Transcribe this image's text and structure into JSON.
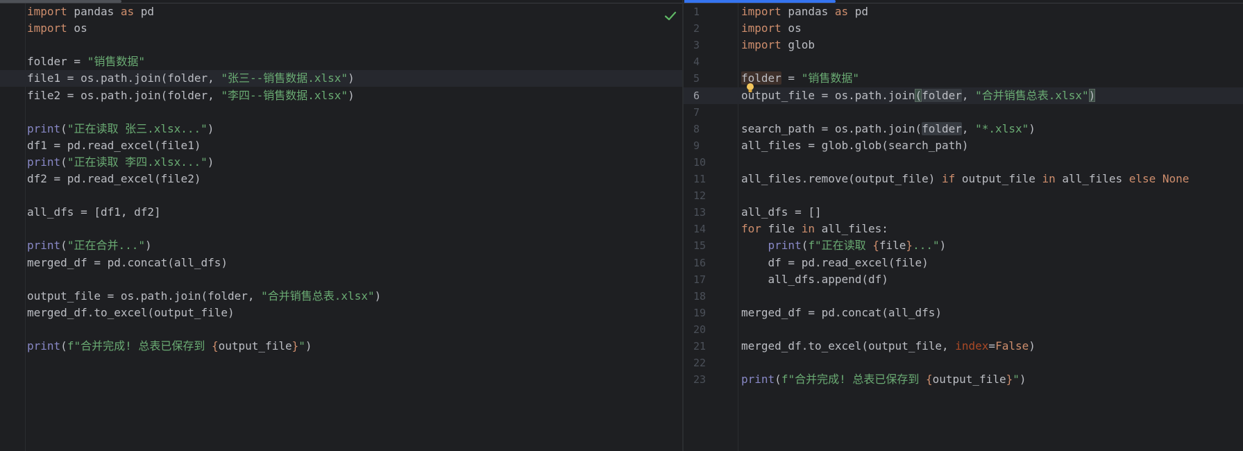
{
  "left_editor": {
    "lines": [
      [
        {
          "t": "import",
          "c": "kw"
        },
        {
          "t": " pandas "
        },
        {
          "t": "as",
          "c": "kw"
        },
        {
          "t": " pd"
        }
      ],
      [
        {
          "t": "import",
          "c": "kw"
        },
        {
          "t": " os"
        }
      ],
      [],
      [
        {
          "t": "folder = "
        },
        {
          "t": "\"销售数据\"",
          "c": "str"
        }
      ],
      [
        {
          "t": "file1 = os.path.join(folder, "
        },
        {
          "t": "\"张三--销售数据.xlsx\"",
          "c": "str"
        },
        {
          "t": ")"
        }
      ],
      [
        {
          "t": "file2 = os.path.join(folder, "
        },
        {
          "t": "\"李四--销售数据.xlsx\"",
          "c": "str"
        },
        {
          "t": ")"
        }
      ],
      [],
      [
        {
          "t": "print",
          "c": "fn"
        },
        {
          "t": "("
        },
        {
          "t": "\"正在读取 张三.xlsx...\"",
          "c": "str"
        },
        {
          "t": ")"
        }
      ],
      [
        {
          "t": "df1 = pd.read_excel(file1)"
        }
      ],
      [
        {
          "t": "print",
          "c": "fn"
        },
        {
          "t": "("
        },
        {
          "t": "\"正在读取 李四.xlsx...\"",
          "c": "str"
        },
        {
          "t": ")"
        }
      ],
      [
        {
          "t": "df2 = pd.read_excel(file2)"
        }
      ],
      [],
      [
        {
          "t": "all_dfs = [df1, df2]"
        }
      ],
      [],
      [
        {
          "t": "print",
          "c": "fn"
        },
        {
          "t": "("
        },
        {
          "t": "\"正在合并...\"",
          "c": "str"
        },
        {
          "t": ")"
        }
      ],
      [
        {
          "t": "merged_df = pd.concat(all_dfs)"
        }
      ],
      [],
      [
        {
          "t": "output_file = os.path.join(folder, "
        },
        {
          "t": "\"合并销售总表.xlsx\"",
          "c": "str"
        },
        {
          "t": ")"
        }
      ],
      [
        {
          "t": "merged_df.to_excel(output_file)"
        }
      ],
      [],
      [
        {
          "t": "print",
          "c": "fn"
        },
        {
          "t": "("
        },
        {
          "t": "f\"合并完成! 总表已保存到 ",
          "c": "str"
        },
        {
          "t": "{",
          "c": "brace"
        },
        {
          "t": "output_file"
        },
        {
          "t": "}",
          "c": "brace"
        },
        {
          "t": "\"",
          "c": "str"
        },
        {
          "t": ")"
        }
      ]
    ]
  },
  "right_editor": {
    "line_numbers": [
      "1",
      "2",
      "3",
      "4",
      "5",
      "6",
      "7",
      "8",
      "9",
      "10",
      "11",
      "12",
      "13",
      "14",
      "15",
      "16",
      "17",
      "18",
      "19",
      "20",
      "21",
      "22",
      "23"
    ],
    "lines": [
      [
        {
          "t": "import",
          "c": "kw"
        },
        {
          "t": " pandas "
        },
        {
          "t": "as",
          "c": "kw"
        },
        {
          "t": " pd"
        }
      ],
      [
        {
          "t": "import",
          "c": "kw"
        },
        {
          "t": " os"
        }
      ],
      [
        {
          "t": "import",
          "c": "kw"
        },
        {
          "t": " glob"
        }
      ],
      [],
      [
        {
          "t": "folder",
          "c": "hl-decl"
        },
        {
          "t": " = "
        },
        {
          "t": "\"销售数据\"",
          "c": "str"
        }
      ],
      [
        {
          "t": "output_file = os.path.join"
        },
        {
          "t": "(",
          "c": "brace-match"
        },
        {
          "t": "folder",
          "c": "hl-usage"
        },
        {
          "t": ", "
        },
        {
          "t": "\"合并销售总表.xlsx\"",
          "c": "str"
        },
        {
          "t": ")",
          "c": "brace-match"
        }
      ],
      [],
      [
        {
          "t": "search_path = os.path.join("
        },
        {
          "t": "folder",
          "c": "hl-usage"
        },
        {
          "t": ", "
        },
        {
          "t": "\"*.xlsx\"",
          "c": "str"
        },
        {
          "t": ")"
        }
      ],
      [
        {
          "t": "all_files = glob.glob(search_path)"
        }
      ],
      [],
      [
        {
          "t": "all_files.remove(output_file) "
        },
        {
          "t": "if",
          "c": "kw"
        },
        {
          "t": " output_file "
        },
        {
          "t": "in",
          "c": "kw"
        },
        {
          "t": " all_files "
        },
        {
          "t": "else",
          "c": "kw"
        },
        {
          "t": " "
        },
        {
          "t": "None",
          "c": "kw"
        }
      ],
      [],
      [
        {
          "t": "all_dfs = []"
        }
      ],
      [
        {
          "t": "for",
          "c": "kw"
        },
        {
          "t": " file "
        },
        {
          "t": "in",
          "c": "kw"
        },
        {
          "t": " all_files:"
        }
      ],
      [
        {
          "t": "    "
        },
        {
          "t": "print",
          "c": "fn"
        },
        {
          "t": "("
        },
        {
          "t": "f\"正在读取 ",
          "c": "str"
        },
        {
          "t": "{",
          "c": "brace"
        },
        {
          "t": "file"
        },
        {
          "t": "}",
          "c": "brace"
        },
        {
          "t": "...\"",
          "c": "str"
        },
        {
          "t": ")"
        }
      ],
      [
        {
          "t": "    df = pd.read_excel(file)"
        }
      ],
      [
        {
          "t": "    all_dfs.append(df)"
        }
      ],
      [],
      [
        {
          "t": "merged_df = pd.concat(all_dfs)"
        }
      ],
      [],
      [
        {
          "t": "merged_df.to_excel(output_file, "
        },
        {
          "t": "index",
          "c": "prm"
        },
        {
          "t": "="
        },
        {
          "t": "False",
          "c": "kw"
        },
        {
          "t": ")"
        }
      ],
      [],
      [
        {
          "t": "print",
          "c": "fn"
        },
        {
          "t": "("
        },
        {
          "t": "f\"合并完成! 总表已保存到 ",
          "c": "str"
        },
        {
          "t": "{",
          "c": "brace"
        },
        {
          "t": "output_file"
        },
        {
          "t": "}",
          "c": "brace"
        },
        {
          "t": "\"",
          "c": "str"
        },
        {
          "t": ")"
        }
      ]
    ]
  },
  "state": {
    "left_current_line": "5",
    "right_current_line": "6",
    "inspection_icon": "check-icon",
    "intention_icon": "bulb-icon"
  }
}
